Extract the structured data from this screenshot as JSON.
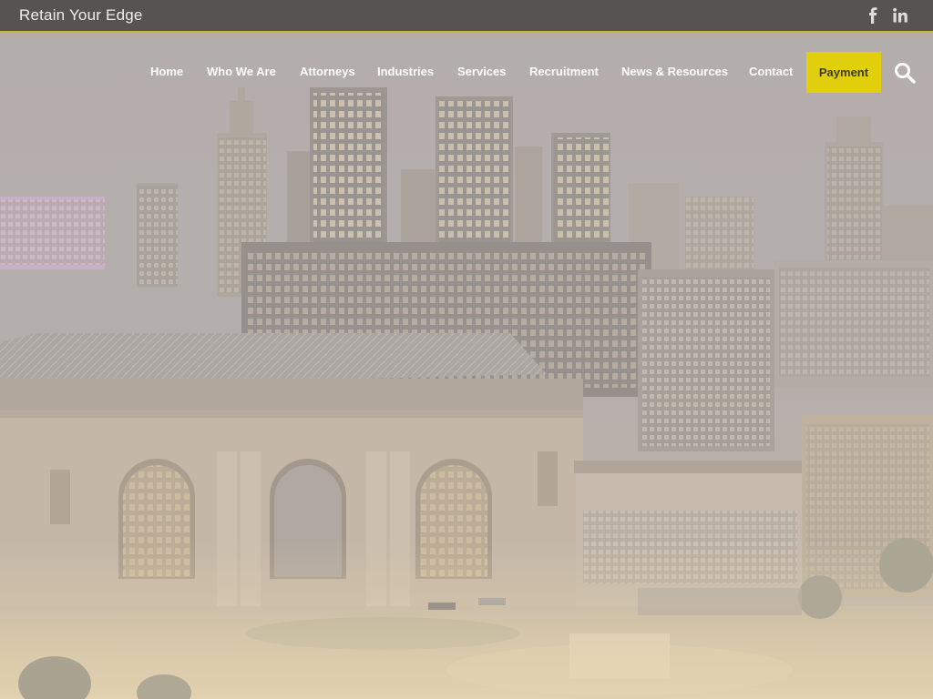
{
  "topbar": {
    "tagline": "Retain Your Edge",
    "social": [
      {
        "name": "facebook",
        "icon": "facebook-icon"
      },
      {
        "name": "linkedin",
        "icon": "linkedin-icon"
      }
    ]
  },
  "nav": {
    "items": [
      {
        "label": "Home"
      },
      {
        "label": "Who We Are"
      },
      {
        "label": "Attorneys"
      },
      {
        "label": "Industries"
      },
      {
        "label": "Services"
      },
      {
        "label": "Recruitment"
      },
      {
        "label": "News & Resources"
      },
      {
        "label": "Contact"
      }
    ],
    "payment_label": "Payment",
    "search_icon": "search-icon"
  },
  "colors": {
    "topbar_bg": "#575350",
    "accent_line": "#c8b832",
    "payment_bg": "#e2cf0c",
    "nav_text": "#ffffff"
  },
  "hero": {
    "background": "city-skyline-at-dusk-with-station-building"
  }
}
